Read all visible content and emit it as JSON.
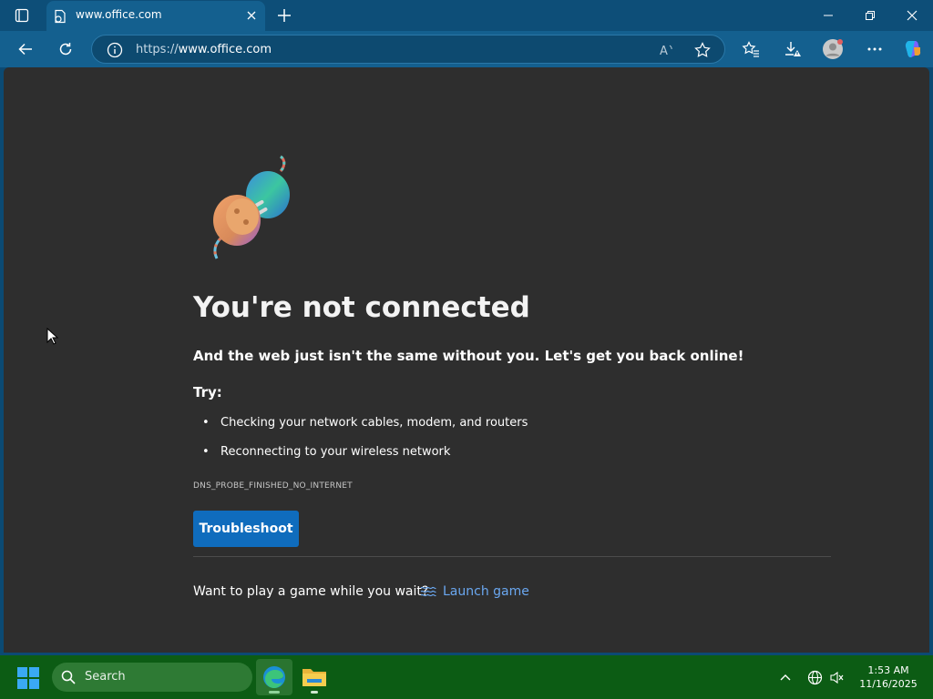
{
  "browser": {
    "tab_title": "www.office.com",
    "url_protocol": "https://",
    "url_host": "www.office.com"
  },
  "error_page": {
    "heading": "You're not connected",
    "subtitle": "And the web just isn't the same without you. Let's get you back online!",
    "try_label": "Try:",
    "tips": [
      "Checking your network cables, modem, and routers",
      "Reconnecting to your wireless network"
    ],
    "error_code": "DNS_PROBE_FINISHED_NO_INTERNET",
    "troubleshoot_label": "Troubleshoot",
    "game_prompt": "Want to play a game while you wait?",
    "launch_game_label": "Launch game"
  },
  "taskbar": {
    "search_label": "Search",
    "time": "1:53 AM",
    "date": "11/16/2025"
  },
  "colors": {
    "accent": "#0f6cbd",
    "link": "#6aa7f0",
    "page_bg": "#2e2e2e",
    "taskbar_bg": "#0c5c14",
    "chrome_bg": "#14608f"
  }
}
